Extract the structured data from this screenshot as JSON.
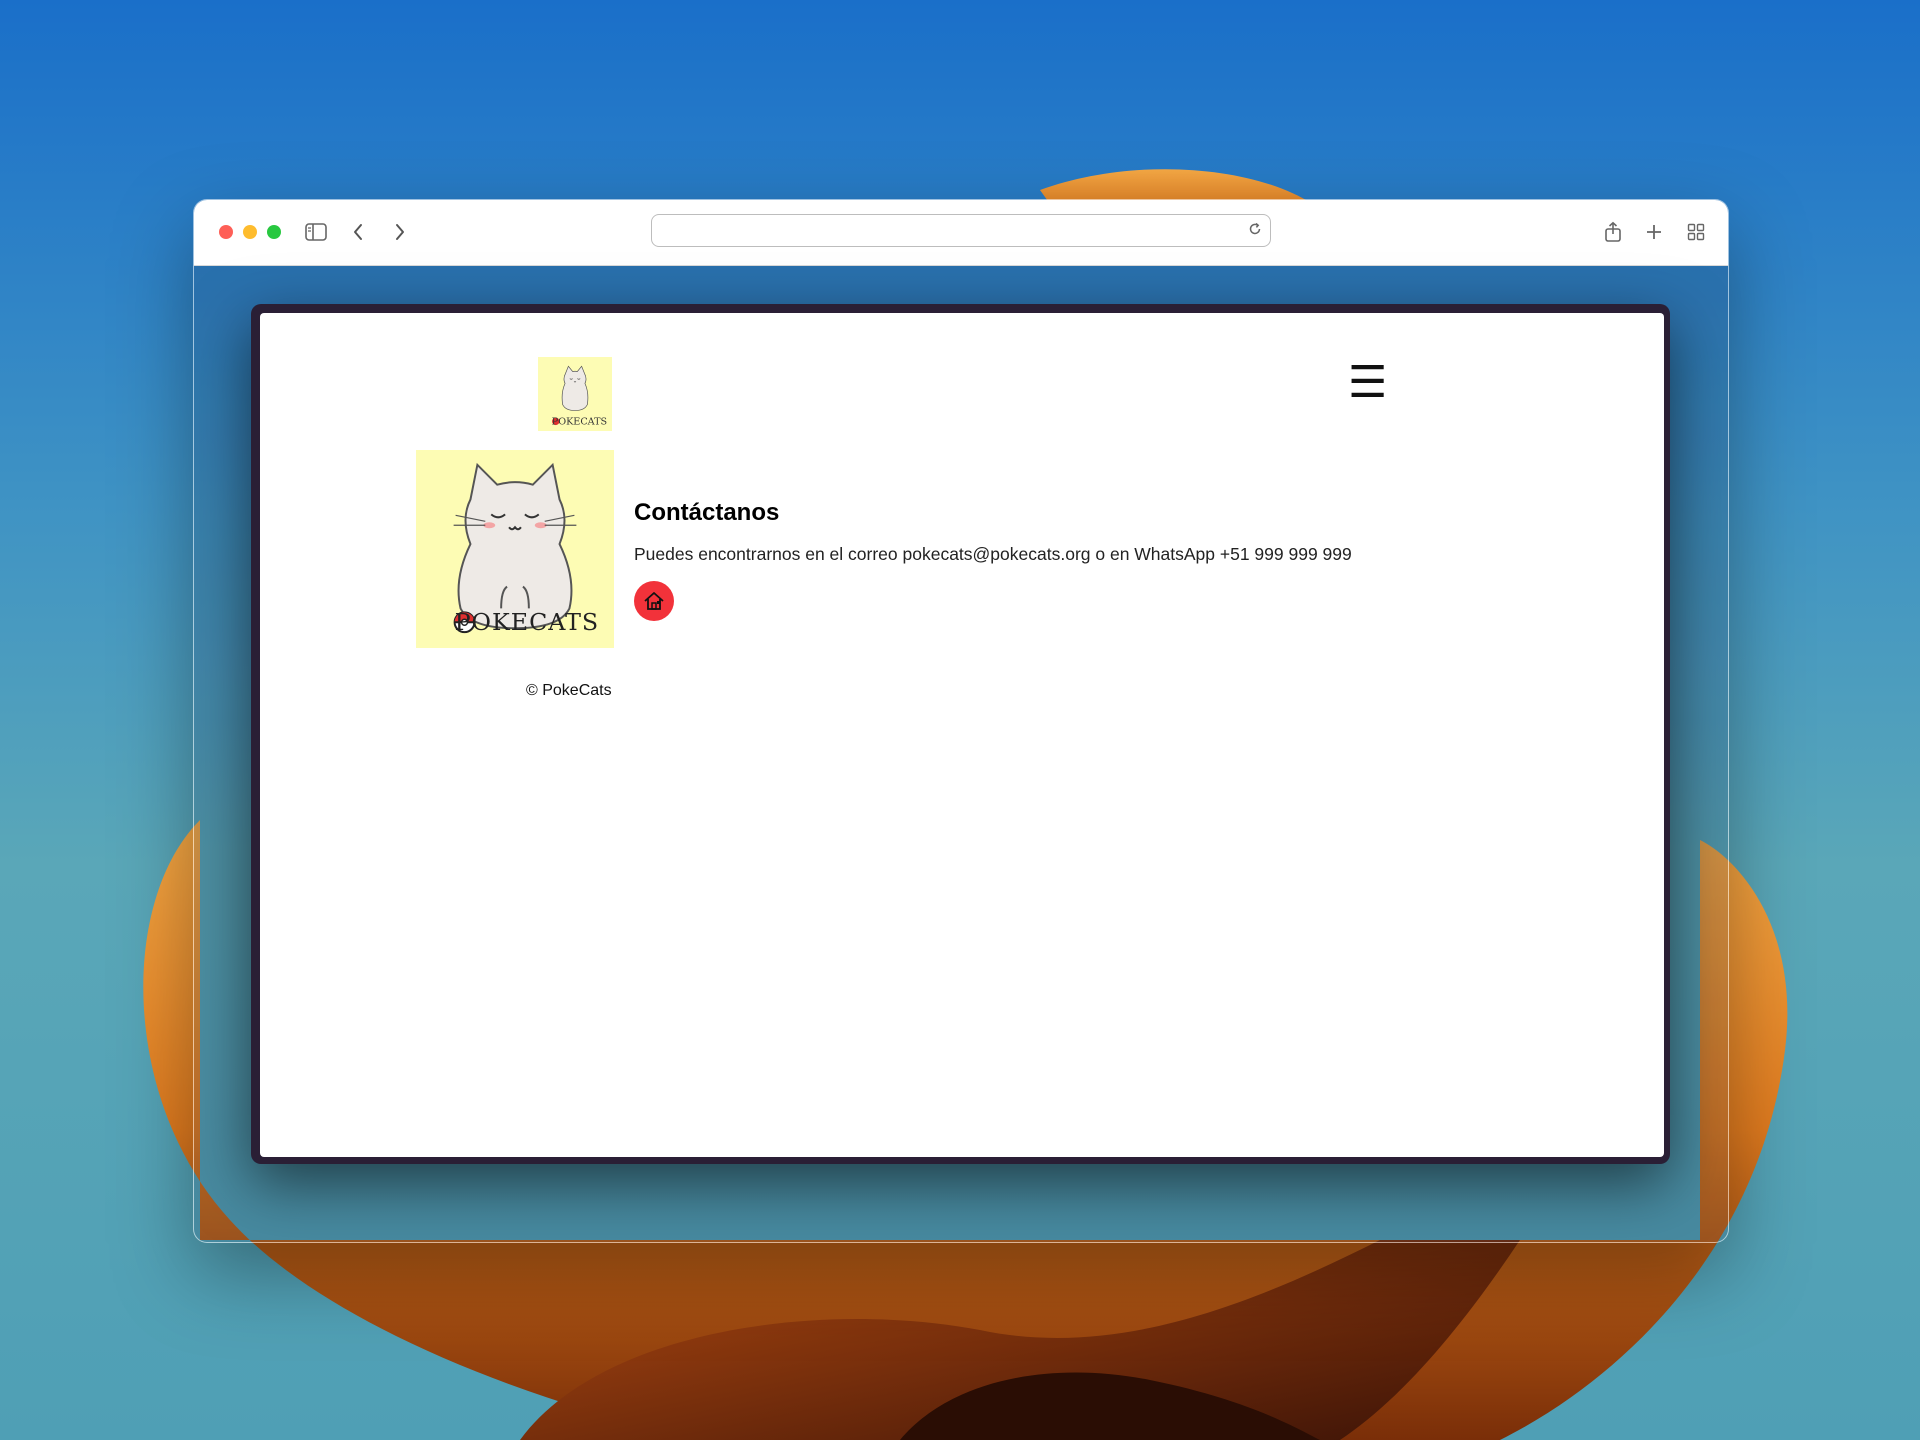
{
  "browser": {
    "url": "",
    "icons": {
      "sidebar": "sidebar-icon",
      "back": "chevron-left-icon",
      "forward": "chevron-right-icon",
      "reload": "reload-icon",
      "share": "share-icon",
      "new_tab": "plus-icon",
      "tabs": "tab-overview-icon"
    }
  },
  "site": {
    "logo_text": "POKECATS",
    "menu_glyph": "☰",
    "heading": "Contáctanos",
    "description": "Puedes encontrarnos en el correo pokecats@pokecats.org o en WhatsApp +51 999 999 999",
    "home_icon": "home-icon",
    "footer": "© PokeCats"
  },
  "colors": {
    "logo_background": "#fdfcb4",
    "home_button": "#f2323a",
    "device_frame": "#2a1f35"
  }
}
